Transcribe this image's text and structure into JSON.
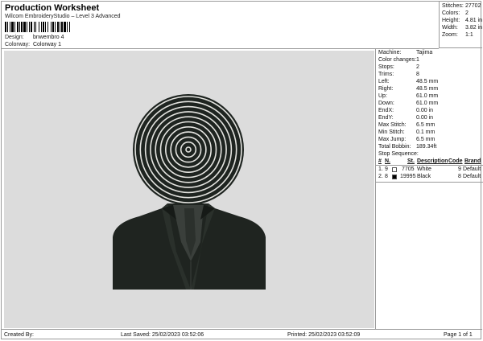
{
  "header": {
    "title": "Production Worksheet",
    "subtitle": "Wilcom EmbroideryStudio – Level 3 Advanced",
    "design_label": "Design:",
    "design_value": "bnwembro 4",
    "colorway_label": "Colorway:",
    "colorway_value": "Colorway 1"
  },
  "stats": [
    {
      "label": "Stitches:",
      "value": "27702"
    },
    {
      "label": "Colors:",
      "value": "2"
    },
    {
      "label": "Height:",
      "value": "4.81 in"
    },
    {
      "label": "Width:",
      "value": "3.82 in"
    },
    {
      "label": "Zoom:",
      "value": "1:1"
    }
  ],
  "info": [
    {
      "label": "Machine:",
      "value": "Tajima"
    },
    {
      "label": "Color changes:",
      "value": "1"
    },
    {
      "label": "Stops:",
      "value": "2"
    },
    {
      "label": "Trims:",
      "value": "8"
    },
    {
      "label": "Left:",
      "value": "48.5 mm"
    },
    {
      "label": "Right:",
      "value": "48.5 mm"
    },
    {
      "label": "Up:",
      "value": "61.0 mm"
    },
    {
      "label": "Down:",
      "value": "61.0 mm"
    },
    {
      "label": "EndX:",
      "value": "0.00 in"
    },
    {
      "label": "EndY:",
      "value": "0.00 in"
    },
    {
      "label": "Max Stitch:",
      "value": "6.5 mm"
    },
    {
      "label": "Min Stitch:",
      "value": "0.1 mm"
    },
    {
      "label": "Max Jump:",
      "value": "6.5 mm"
    },
    {
      "label": "Total Bobbin:",
      "value": "189.34ft"
    }
  ],
  "stop_sequence": {
    "title": "Stop Sequence:",
    "headers": {
      "num": "#",
      "n": "N.",
      "st": "St.",
      "description": "Description",
      "code": "Code",
      "brand": "Brand"
    },
    "rows": [
      {
        "num": "1.",
        "n": "9",
        "swatch": "#ffffff",
        "st": "7705",
        "description": "White",
        "code": "9",
        "brand": "Default"
      },
      {
        "num": "2.",
        "n": "8",
        "swatch": "#000000",
        "st": "19995",
        "description": "Black",
        "code": "8",
        "brand": "Default"
      }
    ]
  },
  "footer": {
    "created_by": "Created By:",
    "last_saved": "Last Saved: 25/02/2023 03:52:06",
    "printed": "Printed: 25/02/2023 03:52:09",
    "page": "Page 1 of 1"
  },
  "colors": {
    "canvas_bg": "#dcdcdc",
    "suit": "#1f2420",
    "rings_dark": "#1e2420",
    "rings_light": "#e4e4e0"
  }
}
